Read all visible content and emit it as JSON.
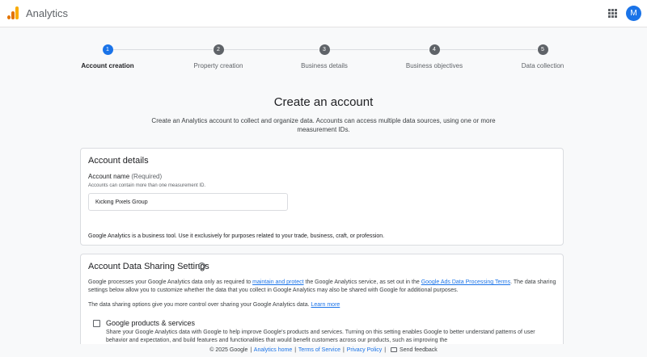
{
  "header": {
    "app_title": "Analytics",
    "avatar_initial": "M",
    "logo_colors": [
      "#e37400",
      "#e37400",
      "#f9ab00"
    ],
    "accent_color": "#1a73e8"
  },
  "stepper": {
    "steps": [
      {
        "number": "1",
        "label": "Account creation",
        "active": true
      },
      {
        "number": "2",
        "label": "Property creation",
        "active": false
      },
      {
        "number": "3",
        "label": "Business details",
        "active": false
      },
      {
        "number": "4",
        "label": "Business objectives",
        "active": false
      },
      {
        "number": "5",
        "label": "Data collection",
        "active": false
      }
    ]
  },
  "page": {
    "title": "Create an account",
    "subtitle": "Create an Analytics account to collect and organize data. Accounts can access multiple data sources, using one or more measurement IDs."
  },
  "account_details": {
    "title": "Account details",
    "field_label": "Account name",
    "field_required": "(Required)",
    "field_hint": "Accounts can contain more than one measurement ID.",
    "field_value": "Kicking Pixels Group",
    "note": "Google Analytics is a business tool. Use it exclusively for purposes related to your trade, business, craft, or profession."
  },
  "sharing": {
    "title": "Account Data Sharing Settings",
    "help_icon": "help-circle-icon",
    "para1_a": "Google processes your Google Analytics data only as required to ",
    "para1_link1": "maintain and protect",
    "para1_b": " the Google Analytics service, as set out in the ",
    "para1_link2": "Google Ads Data Processing Terms",
    "para1_c": ". The data sharing settings below allow you to customize whether the data that you collect in Google Analytics may also be shared with Google for additional purposes.",
    "para2_a": "The data sharing options give you more control over sharing your Google Analytics data. ",
    "para2_link": "Learn more",
    "option_title": "Google products & services",
    "option_desc": "Share your Google Analytics data with Google to help improve Google's products and services. Turning on this setting enables Google to better understand patterns of user behavior and expectation, and build features and functionalities that would benefit customers across our products, such as improving the"
  },
  "footer": {
    "copyright": "© 2025 Google",
    "link_home": "Analytics home",
    "link_terms": "Terms of Service",
    "link_privacy": "Privacy Policy",
    "separator": "|",
    "feedback": "Send feedback"
  }
}
